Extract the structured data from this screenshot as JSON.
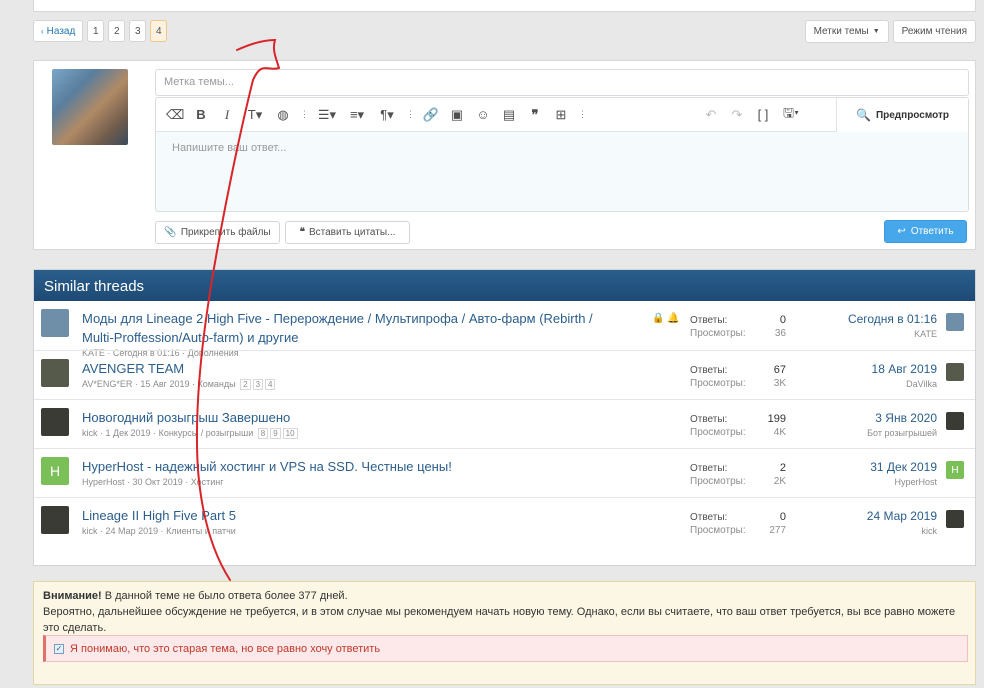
{
  "pager": {
    "prev": "Назад",
    "pages": [
      "1",
      "2",
      "3",
      "4"
    ],
    "current": "4"
  },
  "thread_actions": {
    "tags": "Метки темы",
    "reader_mode": "Режим чтения"
  },
  "reply": {
    "tag_placeholder": "Метка темы...",
    "editor_placeholder": "Напишите ваш ответ...",
    "preview": "Предпросмотр",
    "attach_files": "Прикрепить файлы",
    "insert_quotes": "Вставить цитаты...",
    "submit": "Ответить"
  },
  "toolbar_icons": [
    "eraser-icon",
    "bold-icon",
    "italic-icon",
    "font-size-icon",
    "palette-icon",
    "more-icon",
    "list-icon",
    "align-icon",
    "paragraph-icon",
    "link-icon",
    "image-icon",
    "smiley-icon",
    "media-icon",
    "quote-icon",
    "table-icon",
    "more-icon",
    "undo-icon",
    "redo-icon",
    "bbcode-icon",
    "drafts-icon"
  ],
  "similar": {
    "header": "Similar threads",
    "stat_labels": {
      "replies": "Ответы:",
      "views": "Просмотры:"
    },
    "threads": [
      {
        "title": "Моды для Lineage 2 High Five - Перерождение / Мультипрофа / Авто-фарм (Rebirth / Multi-Proffession/Auto-farm) и другие",
        "author": "KATE",
        "date": "Сегодня в 01:16",
        "forum": "Дополнения",
        "pages": [],
        "replies": "0",
        "views": "36",
        "last_date": "Сегодня в 01:16",
        "last_user": "KATE",
        "avatar_color": "#6f8fa8",
        "has_lock": true
      },
      {
        "title": "AVENGER TEAM",
        "author": "AV*ENG*ER",
        "date": "15 Авг 2019",
        "forum": "Команды",
        "pages": [
          "2",
          "3",
          "4"
        ],
        "replies": "67",
        "views": "3K",
        "last_date": "18 Авг 2019",
        "last_user": "DaVilka",
        "avatar_color": "#555a4a",
        "has_lock": false
      },
      {
        "title": "Новогодний розыгрыш Завершено",
        "author": "kick",
        "date": "1 Дек 2019",
        "forum": "Конкурсы / розыгрыши",
        "pages": [
          "8",
          "9",
          "10"
        ],
        "replies": "199",
        "views": "4K",
        "last_date": "3 Янв 2020",
        "last_user": "Бот розыгрышей",
        "avatar_color": "#3b3b35",
        "has_lock": false
      },
      {
        "title": "HyperHost - надежный хостинг и VPS на SSD. Честные цены!",
        "author": "HyperHost",
        "date": "30 Окт 2019",
        "forum": "Хостинг",
        "pages": [],
        "replies": "2",
        "views": "2K",
        "last_date": "31 Дек 2019",
        "last_user": "HyperHost",
        "avatar_color": "#7bbf58",
        "avatar_letter": "H",
        "has_lock": false
      },
      {
        "title": "Lineage II High Five Part 5",
        "author": "kick",
        "date": "24 Мар 2019",
        "forum": "Клиенты и патчи",
        "pages": [],
        "replies": "0",
        "views": "277",
        "last_date": "24 Мар 2019",
        "last_user": "kick",
        "avatar_color": "#3b3b35",
        "has_lock": false
      }
    ]
  },
  "notice": {
    "strong": "Внимание!",
    "line1": "В данной теме не было ответа более 377 дней.",
    "line2": "Вероятно, дальнейшее обсуждение не требуется, и в этом случае мы рекомендуем начать новую тему. Однако, если вы считаете, что ваш ответ требуется, вы все равно можете это сделать.",
    "confirm": "Я понимаю, что это старая тема, но все равно хочу ответить"
  },
  "colors": {
    "link": "#2b5e8d",
    "accent": "#47a7eb",
    "header": "#1d4a74",
    "scribble": "#d9252a"
  }
}
